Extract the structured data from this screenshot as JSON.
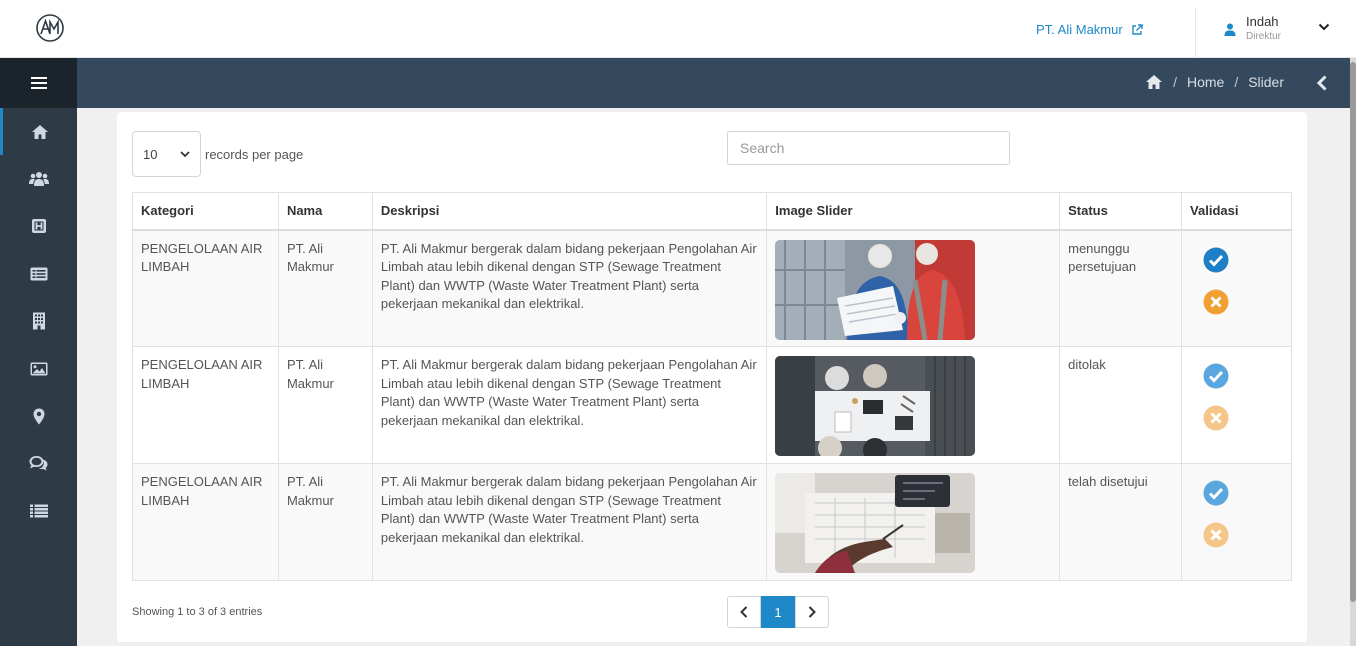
{
  "company": {
    "link_label": "PT. Ali Makmur"
  },
  "user": {
    "name": "Indah",
    "role": "Direktur"
  },
  "breadcrumb": {
    "home": "Home",
    "sep": "/",
    "current": "Slider"
  },
  "datatable": {
    "length_value": "10",
    "length_label": "records per page",
    "search_placeholder": "Search",
    "columns": [
      "Kategori",
      "Nama",
      "Deskripsi",
      "Image Slider",
      "Status",
      "Validasi"
    ],
    "rows": [
      {
        "kategori": "PENGELOLAAN AIR LIMBAH",
        "nama": "PT. Ali Makmur",
        "deskripsi": "PT. Ali Makmur bergerak dalam bidang pekerjaan Pengolahan Air Limbah atau lebih dikenal dengan STP (Sewage Treatment Plant) dan WWTP (Waste Water Treatment Plant) serta pekerjaan mekanikal dan elektrikal.",
        "status": "menunggu persetujuan",
        "image": "workers-reviewing-plans-photo"
      },
      {
        "kategori": "PENGELOLAAN AIR LIMBAH",
        "nama": "PT. Ali Makmur",
        "deskripsi": "PT. Ali Makmur bergerak dalam bidang pekerjaan Pengolahan Air Limbah atau lebih dikenal dengan STP (Sewage Treatment Plant) dan WWTP (Waste Water Treatment Plant) serta pekerjaan mekanikal dan elektrikal.",
        "status": "ditolak",
        "image": "team-meeting-overhead-photo"
      },
      {
        "kategori": "PENGELOLAAN AIR LIMBAH",
        "nama": "PT. Ali Makmur",
        "deskripsi": "PT. Ali Makmur bergerak dalam bidang pekerjaan Pengolahan Air Limbah atau lebih dikenal dengan STP (Sewage Treatment Plant) dan WWTP (Waste Water Treatment Plant) serta pekerjaan mekanikal dan elektrikal.",
        "status": "telah disetujui",
        "image": "architect-drawing-photo"
      }
    ],
    "info": "Showing 1 to 3 of 3 entries",
    "page_current": "1"
  },
  "colors": {
    "accent": "#1e88c8",
    "approve": "#1e7fc6",
    "reject": "#f0a030",
    "sidebar": "#2e3a46",
    "headbar": "#34495e"
  },
  "sidebar_icons": [
    "home-icon",
    "users-icon",
    "hospital-icon",
    "card-list-icon",
    "building-icon",
    "image-icon",
    "map-marker-icon",
    "comments-icon",
    "list-icon"
  ]
}
